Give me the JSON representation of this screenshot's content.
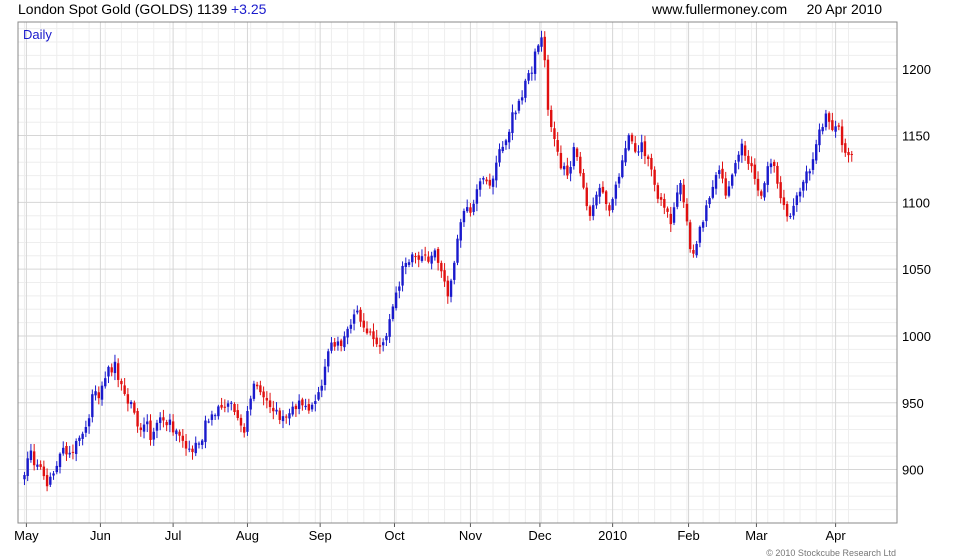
{
  "header": {
    "instrument": "London Spot Gold (GOLDS)",
    "last": "1139",
    "change": "+3.25",
    "site": "www.fullermoney.com",
    "date": "20 Apr 2010"
  },
  "footer": {
    "copyright": "© 2010 Stockcube Research Ltd"
  },
  "colors": {
    "up": "#1a1acc",
    "down": "#e01010",
    "grid": "#d6d6d6",
    "minor_grid": "#eeeeee",
    "axis": "#555555"
  },
  "chart_data": {
    "type": "candlestick",
    "title": "London Spot Gold (GOLDS)",
    "interval_label": "Daily",
    "ylim": [
      860,
      1235
    ],
    "yticks": [
      900,
      950,
      1000,
      1050,
      1100,
      1150,
      1200
    ],
    "x_labels": [
      "May",
      "Jun",
      "Jul",
      "Aug",
      "Sep",
      "Oct",
      "Nov",
      "Dec",
      "2010",
      "Feb",
      "Mar",
      "Apr"
    ],
    "x_label_positions": [
      0.6,
      23.5,
      46,
      69,
      91.5,
      114.5,
      138,
      159.5,
      182,
      205.5,
      226.5,
      251
    ],
    "x_range": [
      -2,
      270
    ],
    "series": [
      {
        "name": "London Spot Gold (GOLDS)",
        "close_path": [
          [
            0,
            895
          ],
          [
            1,
            908
          ],
          [
            2,
            912
          ],
          [
            3,
            905
          ],
          [
            5,
            900
          ],
          [
            7,
            888
          ],
          [
            8,
            892
          ],
          [
            10,
            905
          ],
          [
            12,
            915
          ],
          [
            14,
            910
          ],
          [
            16,
            920
          ],
          [
            18,
            925
          ],
          [
            20,
            938
          ],
          [
            21,
            955
          ],
          [
            22,
            960
          ],
          [
            23,
            955
          ],
          [
            25,
            968
          ],
          [
            26,
            978
          ],
          [
            27,
            975
          ],
          [
            28,
            982
          ],
          [
            29,
            968
          ],
          [
            30,
            962
          ],
          [
            31,
            955
          ],
          [
            32,
            950
          ],
          [
            33,
            948
          ],
          [
            34,
            940
          ],
          [
            35,
            932
          ],
          [
            36,
            930
          ],
          [
            38,
            935
          ],
          [
            39,
            925
          ],
          [
            40,
            930
          ],
          [
            42,
            938
          ],
          [
            44,
            935
          ],
          [
            45,
            938
          ],
          [
            46,
            930
          ],
          [
            47,
            928
          ],
          [
            48,
            925
          ],
          [
            49,
            922
          ],
          [
            50,
            918
          ],
          [
            52,
            912
          ],
          [
            53,
            918
          ],
          [
            55,
            922
          ],
          [
            56,
            935
          ],
          [
            58,
            940
          ],
          [
            60,
            945
          ],
          [
            63,
            950
          ],
          [
            64,
            948
          ],
          [
            66,
            940
          ],
          [
            67,
            935
          ],
          [
            68,
            930
          ],
          [
            69,
            945
          ],
          [
            70,
            955
          ],
          [
            71,
            962
          ],
          [
            72,
            965
          ],
          [
            73,
            955
          ],
          [
            75,
            950
          ],
          [
            76,
            945
          ],
          [
            78,
            942
          ],
          [
            79,
            935
          ],
          [
            80,
            940
          ],
          [
            81,
            942
          ],
          [
            83,
            945
          ],
          [
            85,
            950
          ],
          [
            86,
            948
          ],
          [
            88,
            942
          ],
          [
            90,
            950
          ],
          [
            91,
            955
          ],
          [
            92,
            965
          ],
          [
            93,
            980
          ],
          [
            94,
            990
          ],
          [
            96,
            995
          ],
          [
            98,
            995
          ],
          [
            99,
            1000
          ],
          [
            100,
            1005
          ],
          [
            101,
            1010
          ],
          [
            102,
            1015
          ],
          [
            103,
            1018
          ],
          [
            104,
            1010
          ],
          [
            105,
            1005
          ],
          [
            106,
            1002
          ],
          [
            107,
            1000
          ],
          [
            108,
            998
          ],
          [
            109,
            995
          ],
          [
            110,
            992
          ],
          [
            111,
            998
          ],
          [
            112,
            1000
          ],
          [
            113,
            1010
          ],
          [
            114,
            1020
          ],
          [
            115,
            1030
          ],
          [
            116,
            1040
          ],
          [
            117,
            1050
          ],
          [
            118,
            1055
          ],
          [
            120,
            1060
          ],
          [
            122,
            1055
          ],
          [
            123,
            1060
          ],
          [
            125,
            1058
          ],
          [
            127,
            1062
          ],
          [
            128,
            1055
          ],
          [
            129,
            1048
          ],
          [
            130,
            1040
          ],
          [
            131,
            1032
          ],
          [
            132,
            1040
          ],
          [
            133,
            1055
          ],
          [
            134,
            1070
          ],
          [
            135,
            1085
          ],
          [
            136,
            1092
          ],
          [
            138,
            1095
          ],
          [
            139,
            1100
          ],
          [
            140,
            1110
          ],
          [
            141,
            1115
          ],
          [
            143,
            1118
          ],
          [
            144,
            1112
          ],
          [
            145,
            1120
          ],
          [
            146,
            1130
          ],
          [
            147,
            1138
          ],
          [
            148,
            1142
          ],
          [
            149,
            1145
          ],
          [
            150,
            1155
          ],
          [
            151,
            1165
          ],
          [
            152,
            1170
          ],
          [
            153,
            1175
          ],
          [
            154,
            1180
          ],
          [
            155,
            1190
          ],
          [
            156,
            1195
          ],
          [
            157,
            1200
          ],
          [
            158,
            1210
          ],
          [
            159,
            1218
          ],
          [
            160,
            1222
          ],
          [
            161,
            1205
          ],
          [
            162,
            1170
          ],
          [
            163,
            1155
          ],
          [
            164,
            1145
          ],
          [
            165,
            1135
          ],
          [
            166,
            1125
          ],
          [
            167,
            1130
          ],
          [
            168,
            1118
          ],
          [
            169,
            1125
          ],
          [
            170,
            1140
          ],
          [
            171,
            1135
          ],
          [
            172,
            1122
          ],
          [
            173,
            1110
          ],
          [
            174,
            1100
          ],
          [
            175,
            1090
          ],
          [
            176,
            1098
          ],
          [
            177,
            1105
          ],
          [
            178,
            1112
          ],
          [
            179,
            1110
          ],
          [
            180,
            1100
          ],
          [
            181,
            1095
          ],
          [
            182,
            1100
          ],
          [
            183,
            1112
          ],
          [
            184,
            1120
          ],
          [
            185,
            1130
          ],
          [
            186,
            1140
          ],
          [
            187,
            1150
          ],
          [
            188,
            1145
          ],
          [
            189,
            1135
          ],
          [
            190,
            1140
          ],
          [
            191,
            1142
          ],
          [
            192,
            1135
          ],
          [
            193,
            1130
          ],
          [
            194,
            1125
          ],
          [
            195,
            1112
          ],
          [
            196,
            1105
          ],
          [
            197,
            1100
          ],
          [
            198,
            1098
          ],
          [
            199,
            1090
          ],
          [
            200,
            1085
          ],
          [
            201,
            1098
          ],
          [
            202,
            1105
          ],
          [
            203,
            1112
          ],
          [
            204,
            1100
          ],
          [
            205,
            1085
          ],
          [
            206,
            1065
          ],
          [
            207,
            1062
          ],
          [
            208,
            1070
          ],
          [
            209,
            1080
          ],
          [
            210,
            1088
          ],
          [
            211,
            1095
          ],
          [
            212,
            1105
          ],
          [
            213,
            1112
          ],
          [
            214,
            1118
          ],
          [
            215,
            1125
          ],
          [
            216,
            1115
          ],
          [
            217,
            1108
          ],
          [
            218,
            1112
          ],
          [
            219,
            1120
          ],
          [
            220,
            1128
          ],
          [
            221,
            1138
          ],
          [
            222,
            1142
          ],
          [
            223,
            1135
          ],
          [
            224,
            1130
          ],
          [
            225,
            1125
          ],
          [
            226,
            1118
          ],
          [
            227,
            1110
          ],
          [
            228,
            1105
          ],
          [
            229,
            1112
          ],
          [
            230,
            1125
          ],
          [
            231,
            1130
          ],
          [
            232,
            1125
          ],
          [
            233,
            1112
          ],
          [
            234,
            1105
          ],
          [
            235,
            1095
          ],
          [
            236,
            1088
          ],
          [
            237,
            1092
          ],
          [
            238,
            1100
          ],
          [
            239,
            1105
          ],
          [
            240,
            1110
          ],
          [
            241,
            1118
          ],
          [
            242,
            1122
          ],
          [
            243,
            1125
          ],
          [
            244,
            1135
          ],
          [
            245,
            1145
          ],
          [
            246,
            1152
          ],
          [
            247,
            1158
          ],
          [
            248,
            1165
          ],
          [
            249,
            1160
          ],
          [
            250,
            1155
          ],
          [
            251,
            1158
          ],
          [
            252,
            1155
          ],
          [
            253,
            1145
          ],
          [
            254,
            1136
          ],
          [
            255,
            1138
          ],
          [
            256,
            1139
          ]
        ]
      }
    ],
    "grid": true
  }
}
